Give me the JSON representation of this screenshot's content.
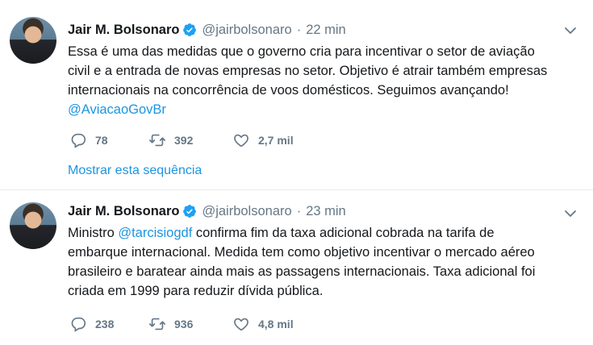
{
  "tweets": [
    {
      "author_name": "Jair M. Bolsonaro",
      "handle": "@jairbolsonaro",
      "separator": "·",
      "time": "22 min",
      "lines": [
        "Essa é uma das medidas que o governo cria para incentivar o setor de aviação",
        "civil e a entrada de novas empresas no setor. Objetivo é atrair também empresas",
        "internacionais na concorrência de voos domésticos. Seguimos avançando!"
      ],
      "mention": "@AviacaoGovBr",
      "replies": "78",
      "retweets": "392",
      "likes": "2,7 mil",
      "show_thread": "Mostrar esta sequência"
    },
    {
      "author_name": "Jair M. Bolsonaro",
      "handle": "@jairbolsonaro",
      "separator": "·",
      "time": "23 min",
      "line1_before": "Ministro ",
      "line1_mention": "@tarcisiogdf",
      "line1_after": " confirma fim da taxa adicional cobrada na tarifa de",
      "lines": [
        "embarque internacional. Medida tem como objetivo incentivar o mercado aéreo",
        "brasileiro e baratear ainda mais as passagens internacionais. Taxa adicional foi",
        "criada em 1999 para reduzir dívida pública."
      ],
      "replies": "238",
      "retweets": "936",
      "likes": "4,8 mil"
    }
  ],
  "colors": {
    "link": "#1b95e0",
    "secondary": "#657786",
    "verified": "#1da1f2",
    "divider": "#e6ecf0"
  }
}
